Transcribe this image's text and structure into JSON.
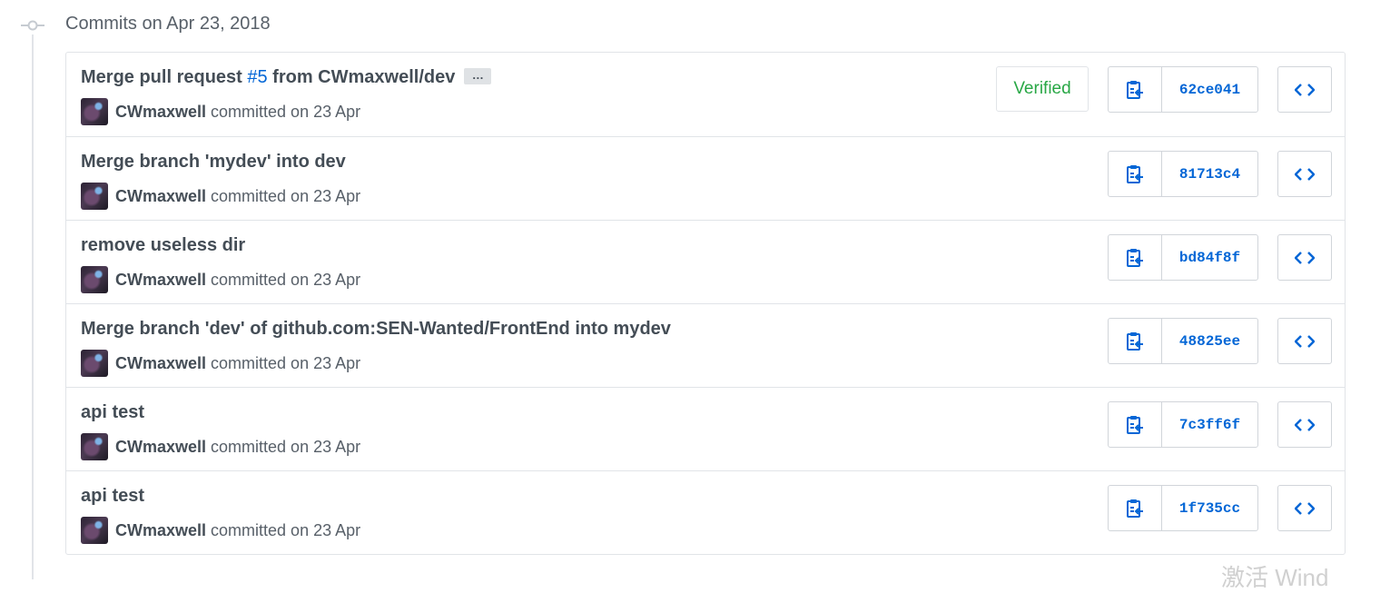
{
  "group": {
    "title": "Commits on Apr 23, 2018"
  },
  "commits": [
    {
      "title_prefix": "Merge pull request ",
      "pr_link": "#5",
      "title_suffix": " from CWmaxwell/dev",
      "ellipsis": "…",
      "author": "CWmaxwell",
      "meta": "committed on 23 Apr",
      "verified": "Verified",
      "sha": "62ce041"
    },
    {
      "title": "Merge branch 'mydev' into dev",
      "author": "CWmaxwell",
      "meta": "committed on 23 Apr",
      "sha": "81713c4"
    },
    {
      "title": "remove useless dir",
      "author": "CWmaxwell",
      "meta": "committed on 23 Apr",
      "sha": "bd84f8f"
    },
    {
      "title": "Merge branch 'dev' of github.com:SEN-Wanted/FrontEnd into mydev",
      "author": "CWmaxwell",
      "meta": "committed on 23 Apr",
      "sha": "48825ee"
    },
    {
      "title": "api test",
      "author": "CWmaxwell",
      "meta": "committed on 23 Apr",
      "sha": "7c3ff6f"
    },
    {
      "title": "api test",
      "author": "CWmaxwell",
      "meta": "committed on 23 Apr",
      "sha": "1f735cc"
    }
  ],
  "icons": {
    "copy": "clipboard-icon",
    "browse": "code-icon",
    "timeline": "commit-node-icon"
  },
  "colors": {
    "link": "#0366d6",
    "verified": "#28a745",
    "text": "#444d56",
    "muted": "#586069"
  },
  "watermark": "激活 Wind"
}
